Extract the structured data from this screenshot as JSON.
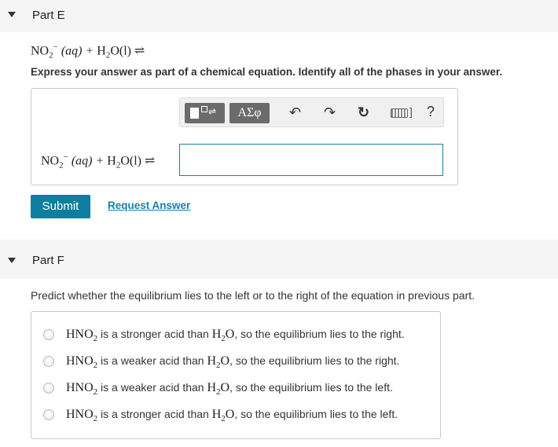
{
  "part_e": {
    "title": "Part E",
    "question_equation": {
      "reactant1": "NO",
      "reactant1_sub": "2",
      "reactant1_charge": "−",
      "reactant1_phase": " (aq) + ",
      "reactant2": "H",
      "reactant2_sub": "2",
      "reactant2_rest": "O(l)",
      "arrow": " ⇌"
    },
    "instruction": "Express your answer as part of a chemical equation. Identify all of the phases in your answer.",
    "toolbar": {
      "greek_label": "ΑΣφ",
      "undo_icon": "↶",
      "redo_icon": "↷",
      "reset_icon": "↻",
      "keyboard_bracket": "]",
      "help_label": "?"
    },
    "answer_prefix": {
      "reactant1": "NO",
      "reactant1_sub": "2",
      "reactant1_charge": "−",
      "reactant1_phase": " (aq) + ",
      "reactant2": "H",
      "reactant2_sub": "2",
      "reactant2_rest": "O(l)",
      "arrow": " ⇌"
    },
    "answer_value": "",
    "submit_label": "Submit",
    "request_answer_label": "Request Answer"
  },
  "part_f": {
    "title": "Part F",
    "prompt": "Predict whether the equilibrium lies to the left or to the right of the equation in previous part.",
    "options": [
      {
        "acid": "HNO",
        "acid_sub": "2",
        "mid": " is a stronger acid than ",
        "water": "H",
        "water_sub": "2",
        "water_rest": "O",
        "tail": ", so the equilibrium lies to the right."
      },
      {
        "acid": "HNO",
        "acid_sub": "2",
        "mid": " is a weaker acid than ",
        "water": "H",
        "water_sub": "2",
        "water_rest": "O",
        "tail": ", so the equilibrium lies to the right."
      },
      {
        "acid": "HNO",
        "acid_sub": "2",
        "mid": " is a weaker acid than ",
        "water": "H",
        "water_sub": "2",
        "water_rest": "O",
        "tail": ", so the equilibrium lies to the left."
      },
      {
        "acid": "HNO",
        "acid_sub": "2",
        "mid": " is a stronger acid than ",
        "water": "H",
        "water_sub": "2",
        "water_rest": "O",
        "tail": ", so the equilibrium lies to the left."
      }
    ]
  },
  "colors": {
    "accent": "#0e7ea0",
    "link": "#1a7fa8",
    "header_bg": "#f5f5f5"
  }
}
